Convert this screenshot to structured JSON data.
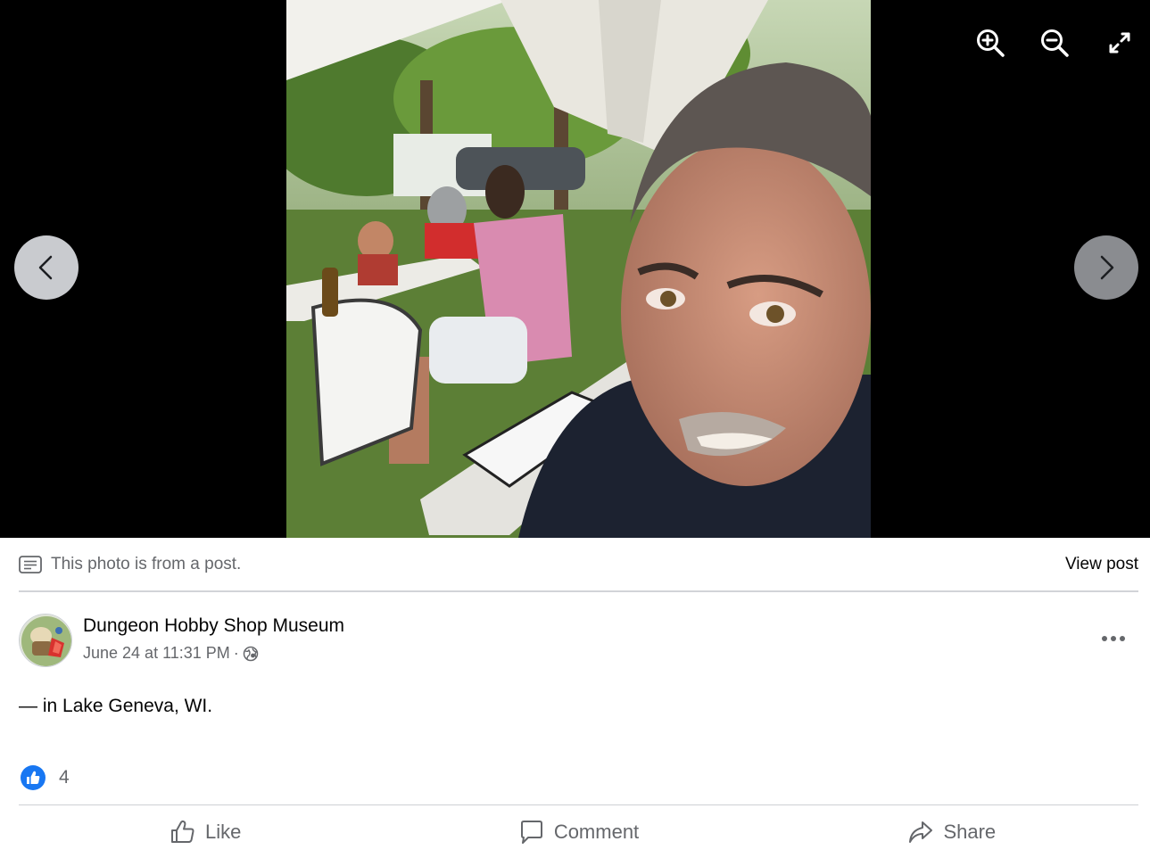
{
  "viewer": {
    "photo_alt": "Selfie under a white canopy with people seated at folding tables outdoors",
    "icons": {
      "zoom_in": "zoom-in-icon",
      "zoom_out": "zoom-out-icon",
      "fullscreen": "fullscreen-icon",
      "previous": "chevron-left-icon",
      "next": "chevron-right-icon"
    }
  },
  "post_notice": {
    "text": "This photo is from a post.",
    "view_post_label": "View post"
  },
  "post": {
    "author_name": "Dungeon Hobby Shop Museum",
    "date": "June 24 at 11:31 PM",
    "separator": "·",
    "privacy": "globe-icon",
    "location_prefix": "— in ",
    "location": "Lake Geneva, WI",
    "location_suffix": "."
  },
  "reactions": {
    "type": "like",
    "count": "4"
  },
  "actions": {
    "like_label": "Like",
    "comment_label": "Comment",
    "share_label": "Share"
  },
  "colors": {
    "viewer_bg": "#000000",
    "like_blue": "#1877f2",
    "muted_text": "#65676b"
  }
}
